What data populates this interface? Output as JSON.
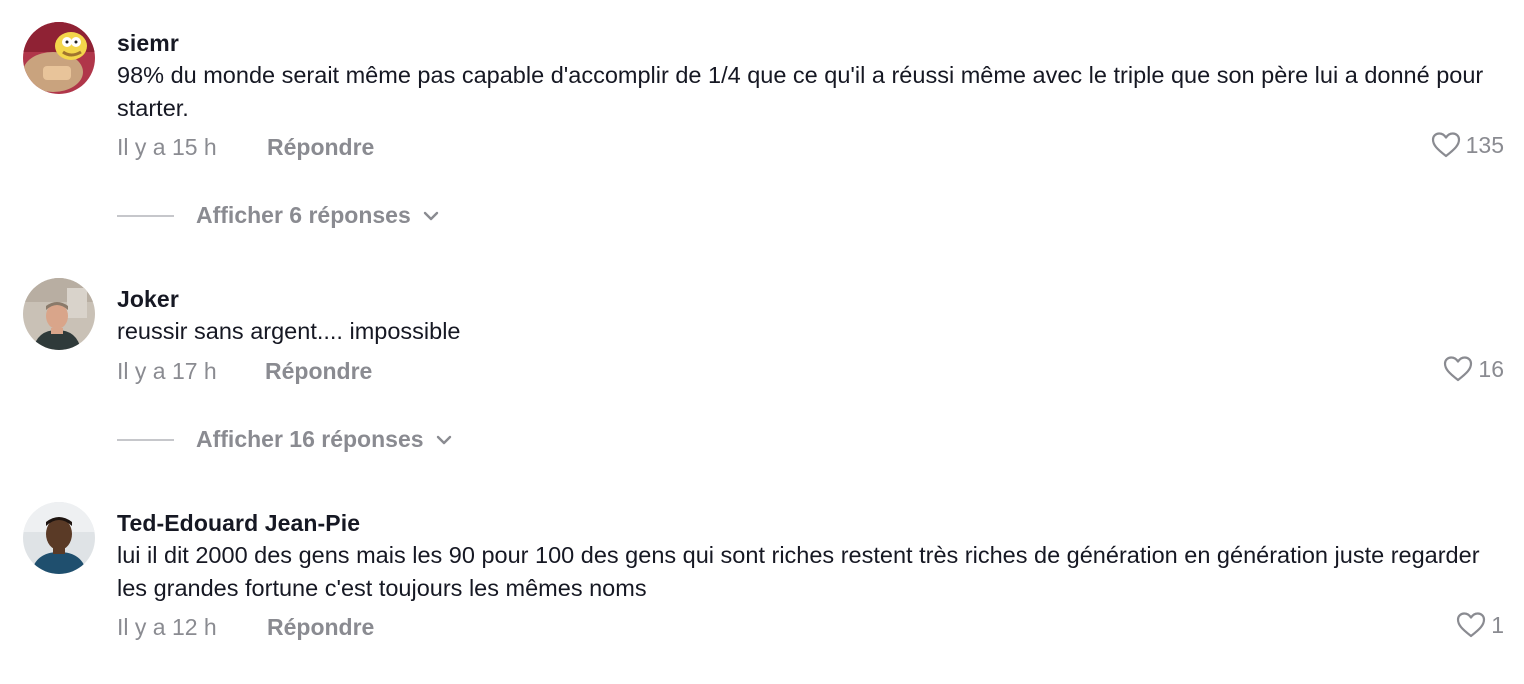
{
  "comments": [
    {
      "username": "siemr",
      "text": "98% du monde serait même pas capable d'accomplir de 1/4 que ce qu'il a réussi même avec le triple que son père lui a donné pour starter.",
      "time": "Il y a 15 h",
      "reply_label": "Répondre",
      "likes": "135",
      "replies_label": "Afficher 6 réponses",
      "avatar": "cartoon-avatar"
    },
    {
      "username": "Joker",
      "text": "reussir sans argent.... impossible",
      "time": "Il y a 17 h",
      "reply_label": "Répondre",
      "likes": "16",
      "replies_label": "Afficher 16 réponses",
      "avatar": "photo-avatar"
    },
    {
      "username": "Ted-Edouard Jean-Pie",
      "text": "lui il dit 2000 des gens mais les 90 pour 100 des gens qui sont riches restent très riches de génération en génération juste regarder les grandes fortune c'est toujours les mêmes noms",
      "time": "Il y a 12 h",
      "reply_label": "Répondre",
      "likes": "1",
      "avatar": "photo-avatar"
    }
  ],
  "icons": {
    "like": "heart-outline-icon",
    "expand": "chevron-down-icon"
  },
  "colors": {
    "primary_text": "#161823",
    "secondary_text": "#8a8b91"
  }
}
